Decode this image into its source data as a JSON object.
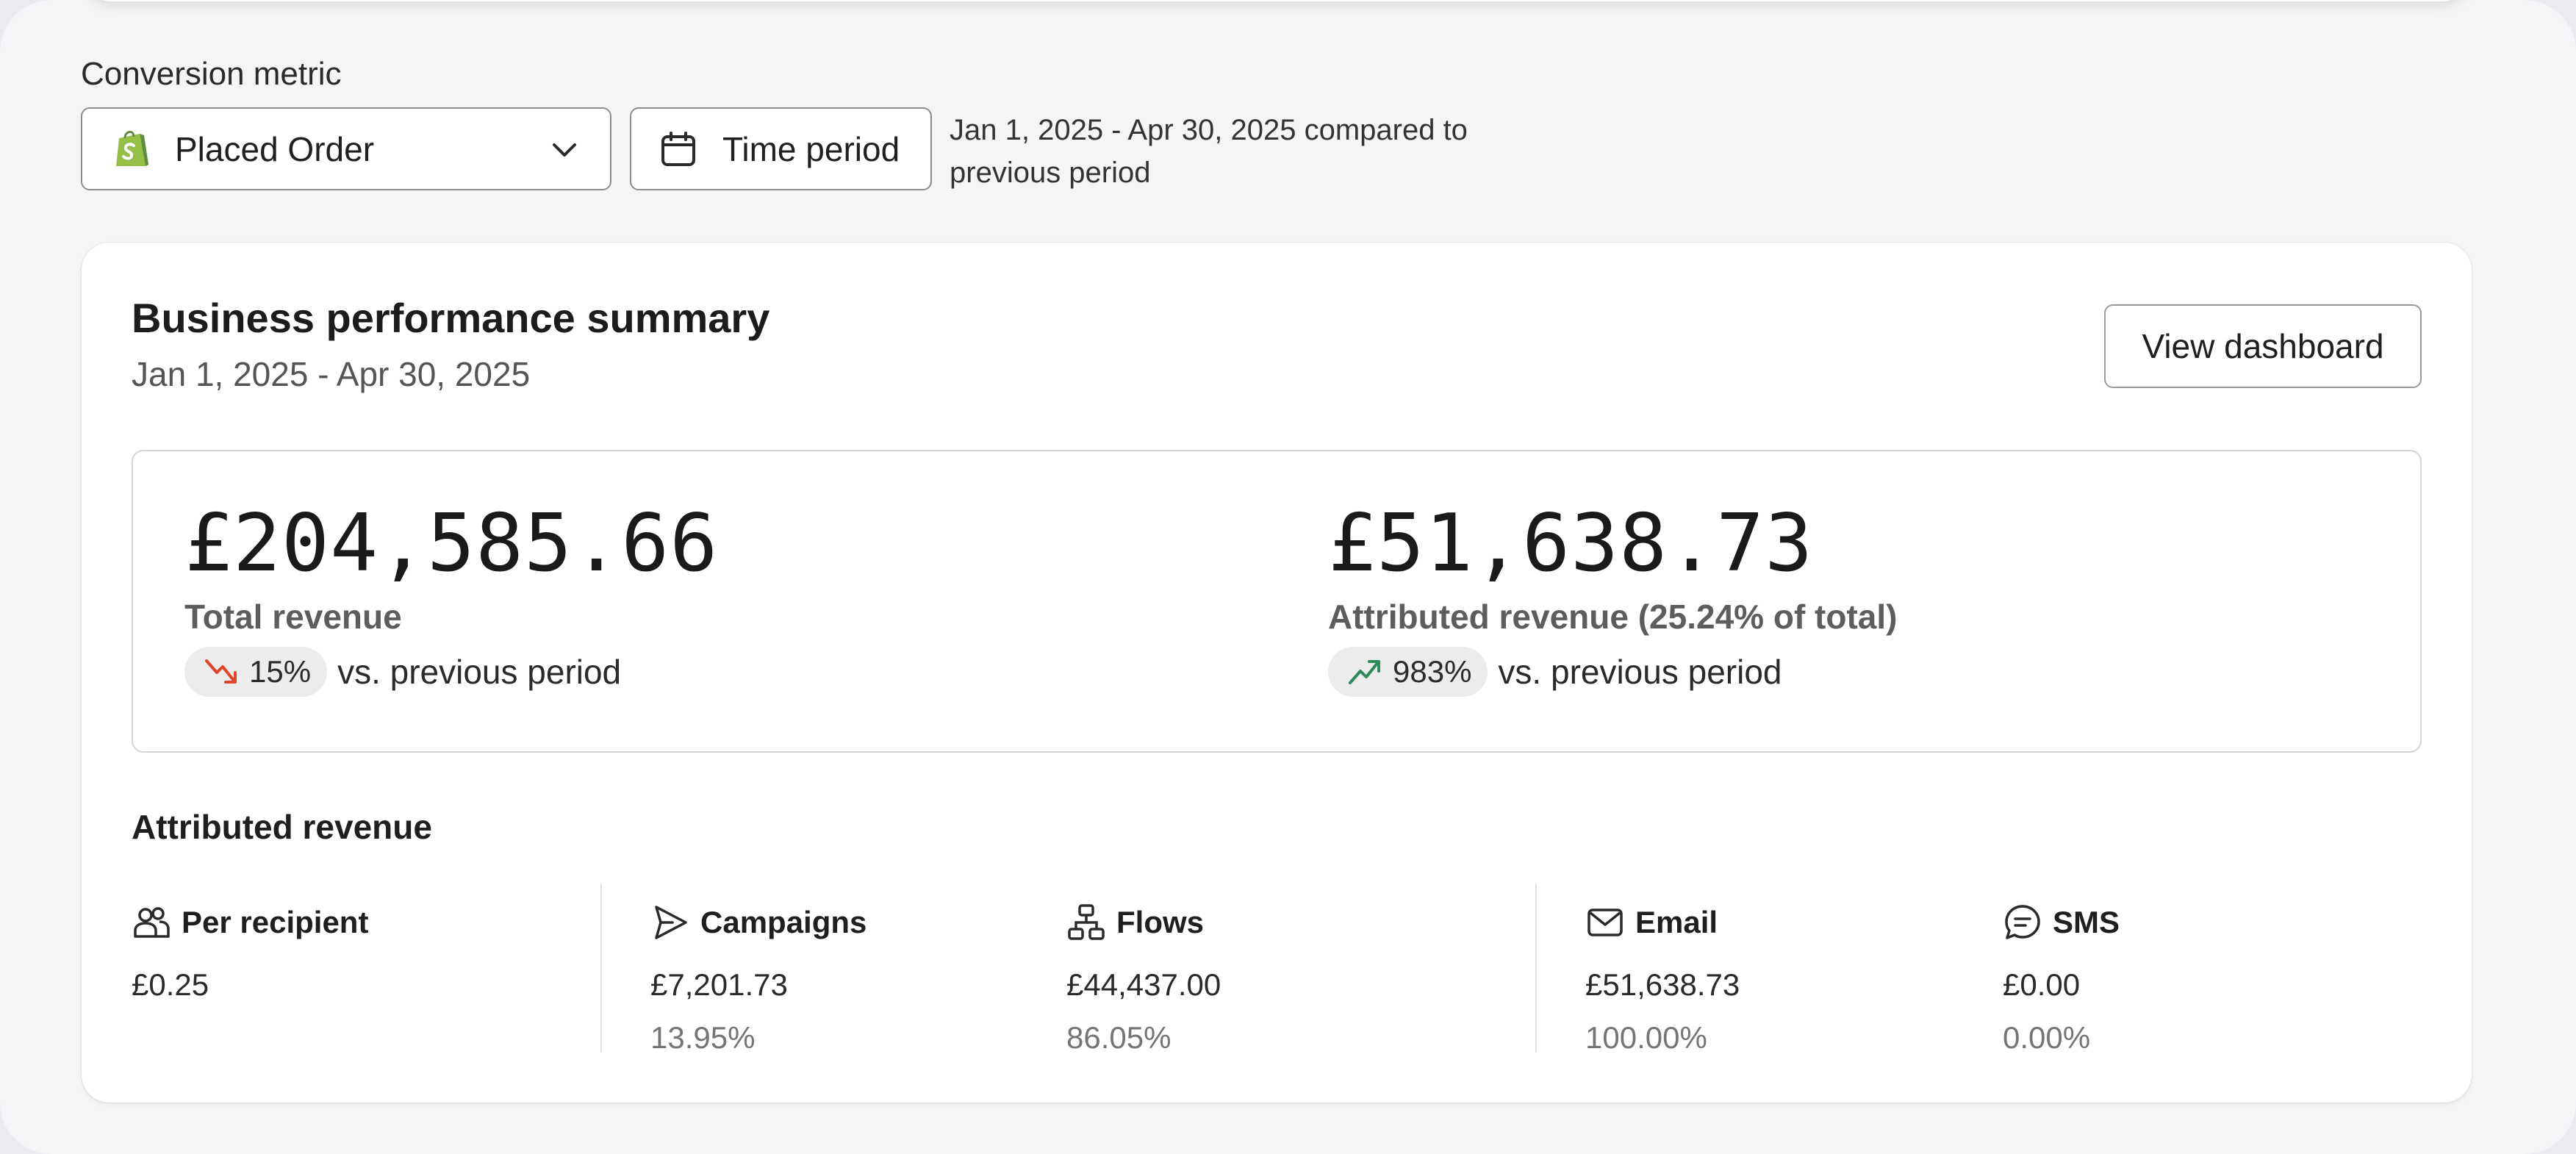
{
  "filters": {
    "metric_label": "Conversion metric",
    "metric_value": "Placed Order",
    "time_period_label": "Time period",
    "compare_text": "Jan 1, 2025 - Apr 30, 2025 compared to previous period"
  },
  "summary": {
    "title": "Business performance summary",
    "date_range": "Jan 1, 2025 - Apr 30, 2025",
    "view_dashboard_label": "View dashboard",
    "total_revenue": {
      "value": "£204,585.66",
      "label": "Total revenue",
      "delta": "15%",
      "delta_direction": "down",
      "comparison": "vs. previous period"
    },
    "attributed_revenue": {
      "value": "£51,638.73",
      "label": "Attributed revenue (25.24% of total)",
      "delta": "983%",
      "delta_direction": "up",
      "comparison": "vs. previous period"
    }
  },
  "attributed": {
    "title": "Attributed revenue",
    "per_recipient": {
      "label": "Per recipient",
      "amount": "£0.25",
      "icon": "people-icon"
    },
    "campaigns": {
      "label": "Campaigns",
      "amount": "£7,201.73",
      "percent": "13.95%",
      "icon": "send-icon"
    },
    "flows": {
      "label": "Flows",
      "amount": "£44,437.00",
      "percent": "86.05%",
      "icon": "flow-icon"
    },
    "email": {
      "label": "Email",
      "amount": "£51,638.73",
      "percent": "100.00%",
      "icon": "mail-icon"
    },
    "sms": {
      "label": "SMS",
      "amount": "£0.00",
      "percent": "0.00%",
      "icon": "chat-icon"
    }
  },
  "colors": {
    "trend_down": "#e0452b",
    "trend_up": "#2e8b57",
    "shopify_green": "#95bf47"
  }
}
